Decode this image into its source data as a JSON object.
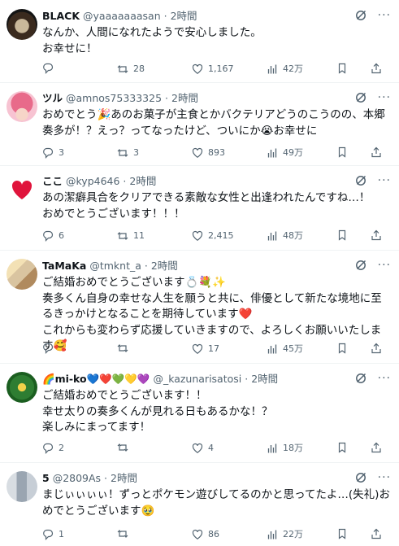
{
  "posts": [
    {
      "name": "BLACK",
      "handle": "@yaaaaaaasan",
      "dot": "·",
      "time": "2時間",
      "text": "なんか、人間になれたようで安心しました。\nお幸せに！",
      "replies": "",
      "retweets": "28",
      "likes": "1,167",
      "views": "42万",
      "avatar_icon": "dark-coffee-avatar"
    },
    {
      "name": "ツル",
      "handle": "@amnos75333325",
      "dot": "·",
      "time": "2時間",
      "text": "おめでとう🎉あのお菓子が主食とかバクテリアどうのこうのの、本郷奏多が！？えっ？ってなったけど、ついにか😭お幸せに",
      "replies": "3",
      "retweets": "3",
      "likes": "893",
      "views": "49万",
      "avatar_icon": "anime-girl-avatar"
    },
    {
      "name": "ここ",
      "handle": "@kyp4646",
      "dot": "·",
      "time": "2時間",
      "text": "あの潔癖具合をクリアできる素敵な女性と出逢われたんですね…！\nおめでとうございます！！！",
      "replies": "6",
      "retweets": "11",
      "likes": "2,415",
      "views": "48万",
      "avatar_icon": "red-heart-avatar"
    },
    {
      "name": "TaMaKa",
      "handle": "@tmknt_a",
      "dot": "·",
      "time": "2時間",
      "text": "ご結婚おめでとうございます💍💐✨\n奏多くん自身の幸せな人生を願うと共に、俳優として新たな境地に至るきっかけとなることを期待しています❤️\nこれからも変わらず応援していきますので、よろしくお願いいたします🥰",
      "replies": "",
      "retweets": "",
      "likes": "17",
      "views": "45万",
      "avatar_icon": "character-group-avatar"
    },
    {
      "name": "🌈mi-ko💙❤️💚💛💜",
      "handle": "@_kazunarisatosi",
      "dot": "·",
      "time": "2時間",
      "text": "ご結婚おめでとうございます！！\n幸せ太りの奏多くんが見れる日もあるかな！？\n楽しみにまってます！",
      "replies": "2",
      "retweets": "",
      "likes": "4",
      "views": "18万",
      "avatar_icon": "green-emblem-avatar"
    },
    {
      "name": "5",
      "handle": "@2809As",
      "dot": "·",
      "time": "2時間",
      "text": "まじぃぃぃぃ！ずっとポケモン遊びしてるのかと思ってたよ…(失礼)おめでとうございます🥹",
      "replies": "1",
      "retweets": "",
      "likes": "86",
      "views": "22万",
      "avatar_icon": "photo-collage-avatar"
    }
  ],
  "icons": {
    "reply": "reply-icon",
    "retweet": "retweet-icon",
    "like": "heart-icon",
    "views": "views-chart-icon",
    "bookmark": "bookmark-icon",
    "share": "share-icon",
    "grok": "grok-icon",
    "more": "more-icon"
  },
  "more_glyph": "···",
  "colors": {
    "text": "#0f1419",
    "secondary": "#536471",
    "divider": "#eff3f4"
  }
}
